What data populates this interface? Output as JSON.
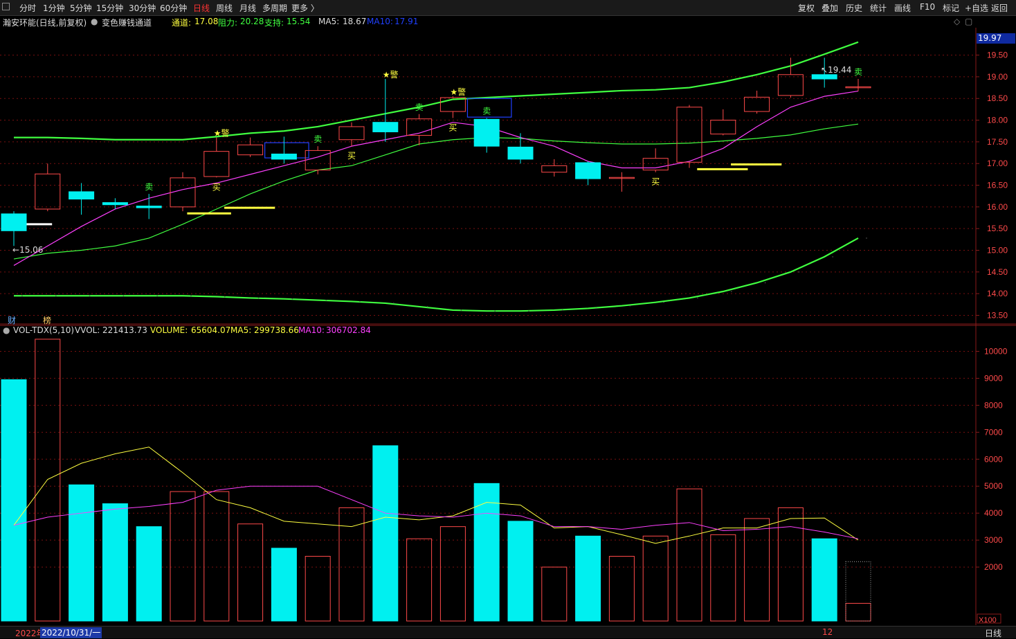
{
  "toolbar": {
    "periods": [
      {
        "label": "分时",
        "active": false
      },
      {
        "label": "1分钟",
        "active": false
      },
      {
        "label": "5分钟",
        "active": false
      },
      {
        "label": "15分钟",
        "active": false
      },
      {
        "label": "30分钟",
        "active": false
      },
      {
        "label": "60分钟",
        "active": false
      },
      {
        "label": "日线",
        "active": true
      },
      {
        "label": "周线",
        "active": false
      },
      {
        "label": "月线",
        "active": false
      },
      {
        "label": "多周期",
        "active": false
      },
      {
        "label": "更多 〉",
        "active": false
      }
    ],
    "tools": [
      "复权",
      "叠加",
      "历史",
      "统计",
      "画线",
      "F10",
      "标记",
      "+自选",
      "返回"
    ]
  },
  "main_info": {
    "stock": "瀚安环能(日线,前复权)",
    "indicator": "变色赚钱通道",
    "channel_label": "通道:",
    "channel_value": "17.08",
    "resist_label": "阻力:",
    "resist_value": "20.28",
    "support_label": "支持:",
    "support_value": "15.54",
    "ma5_label": "MA5:",
    "ma5_value": "18.67",
    "ma10_label": "MA10:",
    "ma10_value": "17.91"
  },
  "vol_info": {
    "name": "VOL-TDX(5,10)",
    "vvol_label": "VVOL:",
    "vvol_value": "221413.73",
    "volume_label": "VOLUME:",
    "volume_value": "65604.07",
    "ma5_label": "MA5:",
    "ma5_value": "299738.66",
    "ma10_label": "MA10:",
    "ma10_value": "306702.84"
  },
  "price_axis": {
    "current": "19.97",
    "ticks": [
      "19.50",
      "19.00",
      "18.50",
      "18.00",
      "17.50",
      "17.00",
      "16.50",
      "16.00",
      "15.50",
      "15.00",
      "14.50",
      "14.00",
      "13.50"
    ]
  },
  "vol_axis": {
    "ticks": [
      "10000",
      "9000",
      "8000",
      "7000",
      "6000",
      "5000",
      "4000",
      "3000",
      "2000"
    ],
    "unit": "X100"
  },
  "annotations": {
    "low": "15.06",
    "high": "19.44",
    "cai": "财",
    "bang": "榜"
  },
  "signal_labels": {
    "buy": "买",
    "sell": "卖",
    "warn": "★警"
  },
  "bottom": {
    "year": "2022年",
    "date": "2022/10/31/一",
    "month": "12",
    "period": "日线"
  },
  "colors": {
    "up": "#ff4a4a",
    "down": "#00f0f0",
    "ma5": "#ff40ff",
    "ma10": "#40ff40",
    "channel": "#40ff40",
    "vol_ma5": "#ffff40",
    "vol_ma10": "#ff40ff",
    "grid": "#7a1010"
  },
  "chart_data": {
    "type": "candlestick",
    "price_ylim": [
      13.3,
      20.1
    ],
    "vol_ylim": [
      0,
      10500
    ],
    "candles": [
      {
        "o": 15.84,
        "h": 15.9,
        "l": 15.1,
        "c": 15.45,
        "v": 8950
      },
      {
        "o": 15.95,
        "h": 17.0,
        "l": 15.9,
        "c": 16.76,
        "v": 10450
      },
      {
        "o": 16.35,
        "h": 16.55,
        "l": 15.82,
        "c": 16.18,
        "v": 5050
      },
      {
        "o": 16.1,
        "h": 16.2,
        "l": 15.95,
        "c": 16.05,
        "v": 4350
      },
      {
        "o": 16.02,
        "h": 16.3,
        "l": 15.72,
        "c": 15.98,
        "v": 3500
      },
      {
        "o": 16.0,
        "h": 16.8,
        "l": 15.9,
        "c": 16.67,
        "v": 4800
      },
      {
        "o": 16.7,
        "h": 17.6,
        "l": 16.68,
        "c": 17.28,
        "v": 4800
      },
      {
        "o": 17.2,
        "h": 17.6,
        "l": 17.15,
        "c": 17.43,
        "v": 3600
      },
      {
        "o": 17.22,
        "h": 17.62,
        "l": 17.0,
        "c": 17.1,
        "v": 2700
      },
      {
        "o": 16.85,
        "h": 17.4,
        "l": 16.75,
        "c": 17.3,
        "v": 2400
      },
      {
        "o": 17.55,
        "h": 17.95,
        "l": 17.4,
        "c": 17.85,
        "v": 4200
      },
      {
        "o": 17.95,
        "h": 18.95,
        "l": 17.5,
        "c": 17.73,
        "v": 6500
      },
      {
        "o": 17.65,
        "h": 18.14,
        "l": 17.42,
        "c": 18.03,
        "v": 3050
      },
      {
        "o": 18.2,
        "h": 18.55,
        "l": 18.05,
        "c": 18.52,
        "v": 3500
      },
      {
        "o": 18.02,
        "h": 18.05,
        "l": 17.25,
        "c": 17.4,
        "v": 5100
      },
      {
        "o": 17.38,
        "h": 17.7,
        "l": 17.0,
        "c": 17.1,
        "v": 3700
      },
      {
        "o": 16.8,
        "h": 17.1,
        "l": 16.7,
        "c": 16.95,
        "v": 2000
      },
      {
        "o": 17.02,
        "h": 17.05,
        "l": 16.5,
        "c": 16.65,
        "v": 3150
      },
      {
        "o": 16.68,
        "h": 16.8,
        "l": 16.35,
        "c": 16.68,
        "v": 2400
      },
      {
        "o": 16.85,
        "h": 17.35,
        "l": 16.8,
        "c": 17.12,
        "v": 3150
      },
      {
        "o": 17.03,
        "h": 18.35,
        "l": 16.9,
        "c": 18.3,
        "v": 4900
      },
      {
        "o": 17.68,
        "h": 18.25,
        "l": 17.65,
        "c": 18.0,
        "v": 3200
      },
      {
        "o": 18.2,
        "h": 18.68,
        "l": 18.15,
        "c": 18.53,
        "v": 3800
      },
      {
        "o": 18.57,
        "h": 19.44,
        "l": 18.52,
        "c": 19.05,
        "v": 4200
      },
      {
        "o": 19.05,
        "h": 19.44,
        "l": 18.75,
        "c": 18.95,
        "v": 3050
      },
      {
        "o": 18.77,
        "h": 18.95,
        "l": 18.67,
        "c": 18.77,
        "v": 656
      }
    ],
    "ma5": [
      14.65,
      15.1,
      15.55,
      15.95,
      16.2,
      16.4,
      16.55,
      16.75,
      16.95,
      17.15,
      17.4,
      17.55,
      17.7,
      17.95,
      17.85,
      17.6,
      17.4,
      17.05,
      16.9,
      16.9,
      17.05,
      17.35,
      17.85,
      18.3,
      18.55,
      18.67
    ],
    "ma10": [
      14.8,
      14.93,
      15.0,
      15.1,
      15.28,
      15.6,
      15.95,
      16.3,
      16.6,
      16.85,
      16.95,
      17.2,
      17.45,
      17.55,
      17.6,
      17.58,
      17.52,
      17.48,
      17.45,
      17.45,
      17.47,
      17.52,
      17.58,
      17.66,
      17.8,
      17.91
    ],
    "upper": [
      17.6,
      17.6,
      17.58,
      17.55,
      17.55,
      17.55,
      17.62,
      17.7,
      17.75,
      17.85,
      18.0,
      18.15,
      18.3,
      18.48,
      18.52,
      18.56,
      18.6,
      18.64,
      18.68,
      18.7,
      18.75,
      18.88,
      19.05,
      19.25,
      19.52,
      19.8
    ],
    "lower": [
      13.95,
      13.95,
      13.95,
      13.95,
      13.95,
      13.95,
      13.93,
      13.9,
      13.88,
      13.85,
      13.82,
      13.78,
      13.7,
      13.62,
      13.6,
      13.6,
      13.62,
      13.66,
      13.72,
      13.8,
      13.9,
      14.05,
      14.25,
      14.5,
      14.85,
      15.28
    ],
    "vol_ma5": [
      3550,
      5250,
      5850,
      6200,
      6450,
      5500,
      4500,
      4200,
      3700,
      3600,
      3500,
      3850,
      3750,
      3900,
      4400,
      4300,
      3450,
      3500,
      3200,
      2880,
      3150,
      3450,
      3450,
      3800,
      3820,
      3000
    ],
    "vol_ma10": [
      3550,
      3850,
      4000,
      4150,
      4250,
      4400,
      4850,
      5000,
      5000,
      5000,
      4500,
      4000,
      3900,
      3850,
      4000,
      3900,
      3500,
      3500,
      3400,
      3550,
      3650,
      3350,
      3400,
      3500,
      3300,
      3050
    ],
    "buy_signals": [
      6,
      10,
      13,
      19
    ],
    "sell_signals": [
      4,
      9,
      12,
      14,
      25
    ],
    "warn_signals": [
      6,
      11,
      13
    ],
    "support_lines": [
      {
        "from": 0,
        "to": 1.5,
        "price": 15.6,
        "color": "#ffffff"
      },
      {
        "from": 5.5,
        "to": 6.8,
        "price": 15.85,
        "color": "#ffff40"
      },
      {
        "from": 6.6,
        "to": 8.1,
        "price": 15.98,
        "color": "#ffff40"
      },
      {
        "from": 20.6,
        "to": 22.1,
        "price": 16.87,
        "color": "#ffff40"
      },
      {
        "from": 21.6,
        "to": 23.1,
        "price": 16.98,
        "color": "#ffff40"
      }
    ],
    "channel_boxes": [
      {
        "from": 7.8,
        "to": 9.1,
        "top": 17.48,
        "bottom": 17.13
      },
      {
        "from": 13.8,
        "to": 15.1,
        "top": 18.5,
        "bottom": 18.07
      }
    ]
  }
}
